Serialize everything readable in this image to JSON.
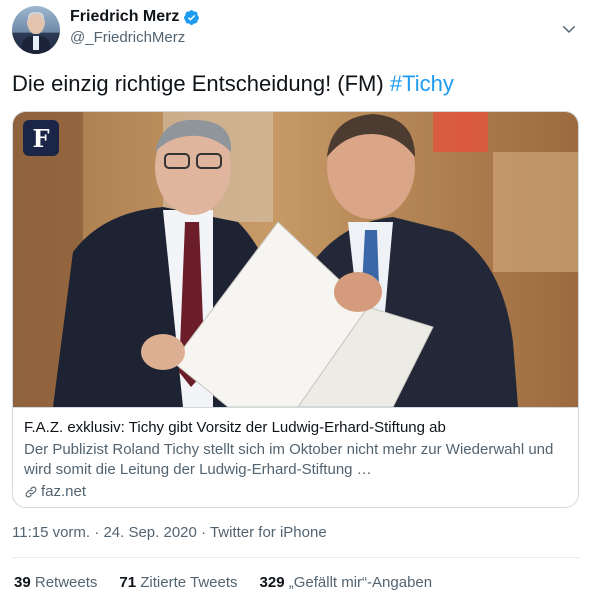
{
  "author": {
    "display_name": "Friedrich Merz",
    "handle": "@_FriedrichMerz",
    "verified_icon": "verified-badge-icon",
    "avatar_icon": "profile-photo"
  },
  "tweet": {
    "text": "Die einzig richtige Entscheidung! (FM)",
    "hashtag": "#Tichy"
  },
  "card": {
    "publisher_logo": "F",
    "title": "F.A.Z. exklusiv: Tichy gibt Vorsitz der Ludwig-Erhard-Stiftung ab",
    "description": "Der Publizist Roland Tichy stellt sich im Oktober nicht mehr zur Wiederwahl und wird somit die Leitung der Ludwig-Erhard-Stiftung …",
    "domain": "faz.net",
    "link_icon": "link-icon"
  },
  "meta": {
    "time": "11:15 vorm.",
    "separator": "·",
    "date": "24. Sep. 2020",
    "source": "Twitter for iPhone"
  },
  "stats": {
    "retweets_count": "39",
    "retweets_label": "Retweets",
    "quotes_count": "71",
    "quotes_label": "Zitierte Tweets",
    "likes_count": "329",
    "likes_label": "„Gefällt mir“-Angaben"
  },
  "colors": {
    "accent": "#1d9bf0",
    "text": "#0f1419",
    "secondary": "#536471",
    "border": "#cfd9de"
  }
}
